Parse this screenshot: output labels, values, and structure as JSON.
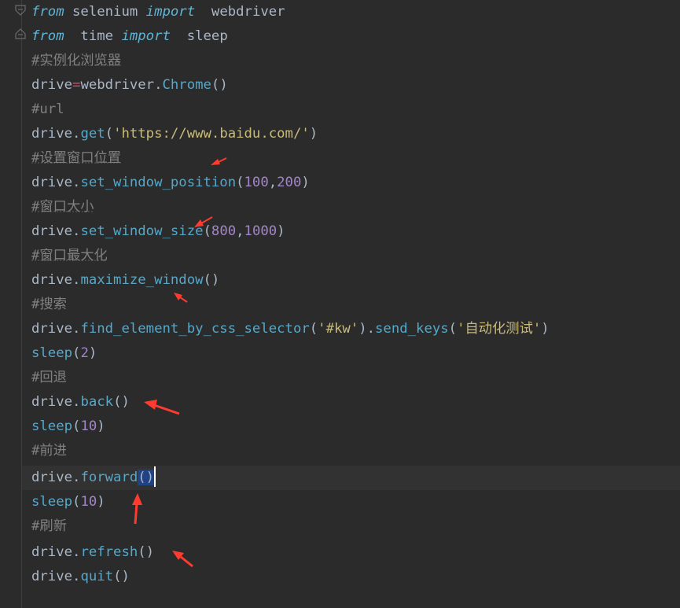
{
  "code": {
    "l1": {
      "from": "from",
      "mod": " selenium ",
      "import": "import",
      "name": "  webdriver"
    },
    "l2": {
      "from": "from",
      "mod": "  time ",
      "import": "import",
      "name": "  sleep"
    },
    "l3": {
      "comment": "#实例化浏览器"
    },
    "l4": {
      "obj": "drive",
      "eq": "=",
      "mod": "webdriver.",
      "cls": "Chrome",
      "args": "()"
    },
    "l5": {
      "comment": "#url"
    },
    "l6": {
      "obj": "drive.",
      "fn": "get",
      "open": "(",
      "str": "'https://www.baidu.com/'",
      "close": ")"
    },
    "l7": {
      "comment": "#设置窗口位置"
    },
    "l8": {
      "obj": "drive.",
      "fn": "set_window_position",
      "open": "(",
      "n1": "100",
      "comma": ",",
      "n2": "200",
      "close": ")"
    },
    "l9": {
      "comment": "#窗口大小"
    },
    "l10": {
      "obj": "drive.",
      "fn": "set_window_size",
      "open": "(",
      "n1": "800",
      "comma": ",",
      "n2": "1000",
      "close": ")"
    },
    "l11": {
      "comment": "#窗口最大化"
    },
    "l12": {
      "obj": "drive.",
      "fn": "maximize_window",
      "args": "()"
    },
    "l13": {
      "comment": "#搜索"
    },
    "l14": {
      "obj": "drive.",
      "fn": "find_element_by_css_selector",
      "open": "(",
      "str": "'#kw'",
      "mid": ").",
      "fn2": "send_keys",
      "open2": "(",
      "str2": "'自动化测试'",
      "close": ")"
    },
    "l15": {
      "fn": "sleep",
      "open": "(",
      "n": "2",
      "close": ")"
    },
    "l16": {
      "comment": "#回退"
    },
    "l17": {
      "obj": "drive.",
      "fn": "back",
      "args": "()"
    },
    "l18": {
      "fn": "sleep",
      "open": "(",
      "n": "10",
      "close": ")"
    },
    "l19": {
      "comment": "#前进"
    },
    "l20": {
      "obj": "drive.",
      "fn": "forward",
      "args": "()"
    },
    "l21": {
      "fn": "sleep",
      "open": "(",
      "n": "10",
      "close": ")"
    },
    "l22": {
      "comment": "#刷新"
    },
    "l23": {
      "obj": "drive.",
      "fn": "refresh",
      "args": "()"
    },
    "l24": {
      "obj": "drive.",
      "fn": "quit",
      "args": "()"
    }
  },
  "annotations": {
    "arrow_color": "#ff3b30",
    "arrow_icon": "red-arrow-icon"
  }
}
